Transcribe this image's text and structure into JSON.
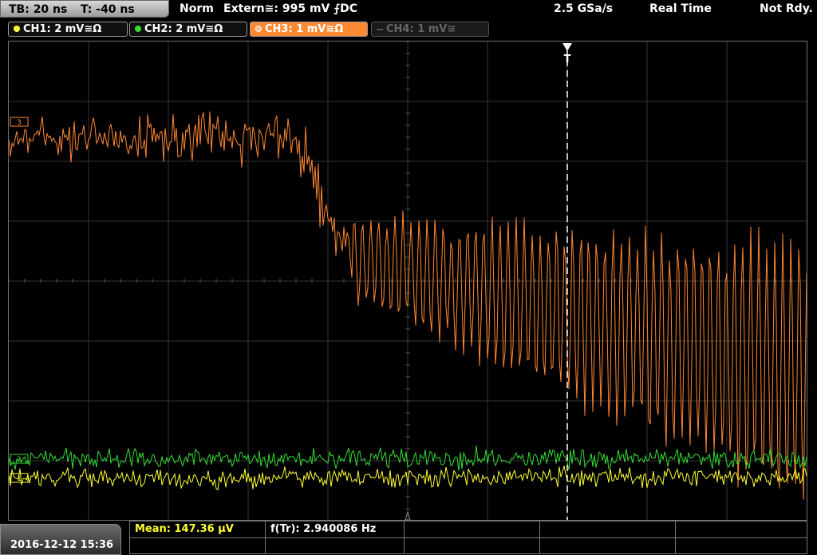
{
  "status": {
    "tb": "TB: 20 ns",
    "t": "T: -40 ns",
    "mode": "Norm",
    "trigger": "Extern≅: 995 mV ⨍DC",
    "sample_rate": "2.5 GSa/s",
    "acq": "Real Time",
    "state": "Not Rdy."
  },
  "channels": [
    {
      "label": "CH1: 2 mV≅Ω",
      "color": "#ffff33",
      "active": true
    },
    {
      "label": "CH2: 2 mV≅Ω",
      "color": "#33dd33",
      "active": true
    },
    {
      "label": "CH3: 1 mV≅Ω",
      "color": "#ff8833",
      "active": true
    },
    {
      "label": "CH4: 1 mV≅",
      "color": "#666666",
      "active": false
    }
  ],
  "markers": {
    "trigger": "T",
    "ch3": "3",
    "ch2": "2",
    "ch1": "1"
  },
  "measurements": {
    "mean": "Mean: 147.36 μV",
    "freq": "f(Tr): 2.940086 Hz"
  },
  "datetime": "2016-12-12 15:36",
  "colors": {
    "ch1": "#ffff33",
    "ch2": "#33dd33",
    "ch3": "#ff8833",
    "grid": "#3a3a3a"
  }
}
